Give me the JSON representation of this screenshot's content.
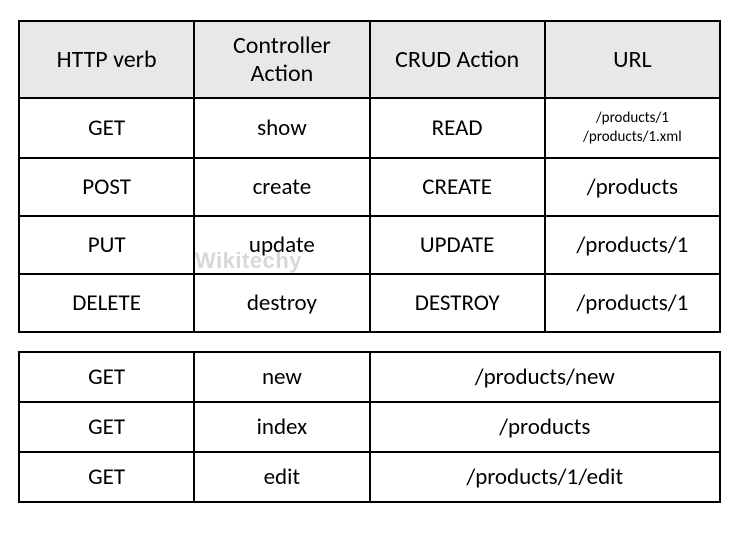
{
  "chart_data": [
    {
      "type": "table",
      "title": "HTTP verbs to CRUD actions",
      "headers": [
        "HTTP verb",
        "Controller\nAction",
        "CRUD Action",
        "URL"
      ],
      "rows": [
        [
          "GET",
          "show",
          "READ",
          "/products/1\n/products/1.xml"
        ],
        [
          "POST",
          "create",
          "CREATE",
          "/products"
        ],
        [
          "PUT",
          "update",
          "UPDATE",
          "/products/1"
        ],
        [
          "DELETE",
          "destroy",
          "DESTROY",
          "/products/1"
        ]
      ]
    },
    {
      "type": "table",
      "title": "Additional GET routes",
      "columns": [
        "HTTP verb",
        "Controller Action",
        "URL"
      ],
      "rows": [
        [
          "GET",
          "new",
          "/products/new"
        ],
        [
          "GET",
          "index",
          "/products"
        ],
        [
          "GET",
          "edit",
          "/products/1/edit"
        ]
      ]
    }
  ],
  "table1": {
    "headers": {
      "c0": "HTTP verb",
      "c1": "Controller\nAction",
      "c2": "CRUD Action",
      "c3": "URL"
    },
    "rows": [
      {
        "verb": "GET",
        "action": "show",
        "crud": "READ",
        "url": "/products/1\n/products/1.xml",
        "url_small": true
      },
      {
        "verb": "POST",
        "action": "create",
        "crud": "CREATE",
        "url": "/products"
      },
      {
        "verb": "PUT",
        "action": "update",
        "crud": "UPDATE",
        "url": "/products/1"
      },
      {
        "verb": "DELETE",
        "action": "destroy",
        "crud": "DESTROY",
        "url": "/products/1"
      }
    ]
  },
  "table2": {
    "rows": [
      {
        "verb": "GET",
        "action": "new",
        "url": "/products/new"
      },
      {
        "verb": "GET",
        "action": "index",
        "url": "/products"
      },
      {
        "verb": "GET",
        "action": "edit",
        "url": "/products/1/edit"
      }
    ]
  },
  "watermark": "Wikitechy"
}
